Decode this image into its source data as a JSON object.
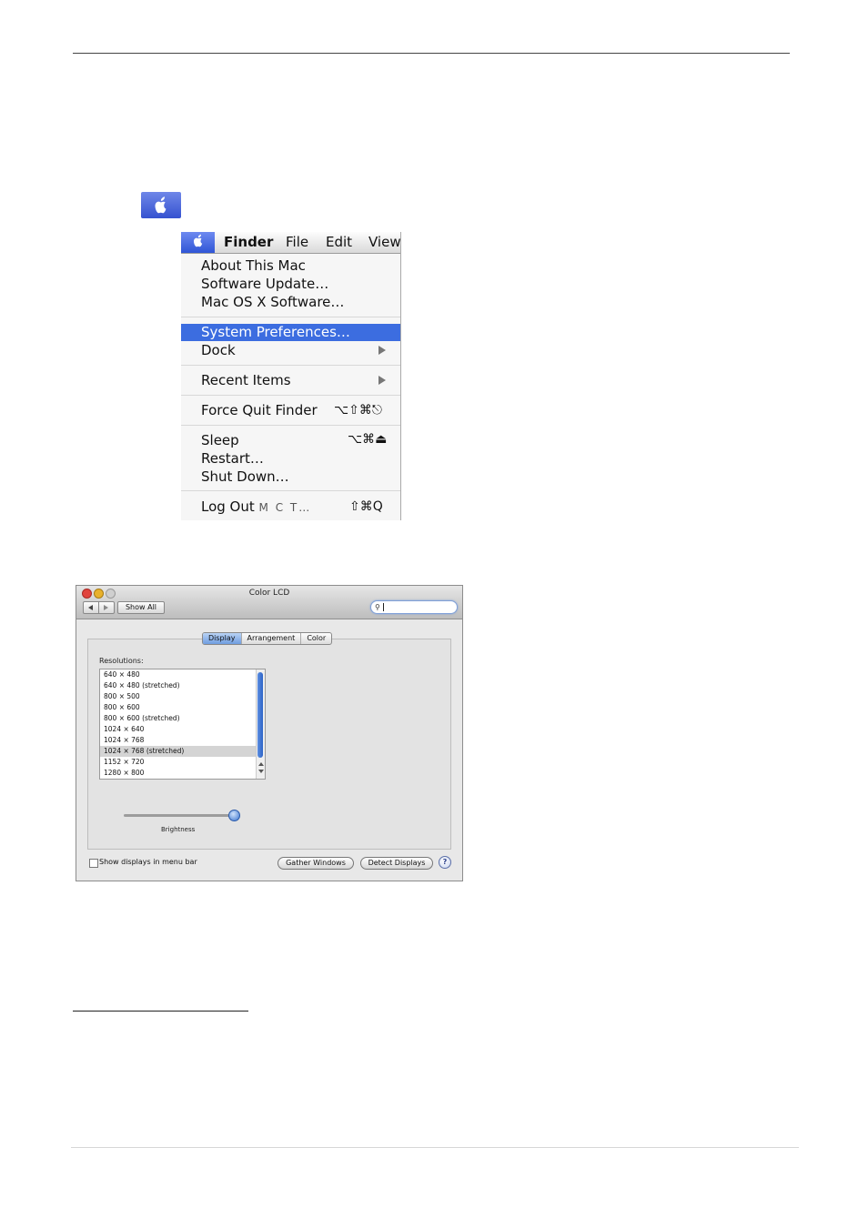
{
  "apple_menu": {
    "menubar": {
      "finder": "Finder",
      "file": "File",
      "edit": "Edit",
      "view": "View"
    },
    "items": {
      "about": "About This Mac",
      "software_update": "Software Update…",
      "macosx_software": "Mac OS X Software…",
      "system_preferences": "System Preferences…",
      "dock": "Dock",
      "recent_items": "Recent Items",
      "force_quit": "Force Quit Finder",
      "force_quit_shortcut": "⌥⇧⌘⎋",
      "sleep": "Sleep",
      "sleep_shortcut": "⌥⌘⏏",
      "restart": "Restart…",
      "shut_down": "Shut Down…",
      "log_out": "Log Out",
      "log_out_user": "M C T…",
      "log_out_shortcut": "⇧⌘Q"
    },
    "highlighted_item": "System Preferences…"
  },
  "prefs_window": {
    "title": "Color LCD",
    "show_all": "Show All",
    "search_placeholder": "",
    "tabs": [
      "Display",
      "Arrangement",
      "Color"
    ],
    "active_tab": "Display",
    "resolutions_label": "Resolutions:",
    "resolutions": [
      "640 × 480",
      "640 × 480 (stretched)",
      "800 × 500",
      "800 × 600",
      "800 × 600 (stretched)",
      "1024 × 640",
      "1024 × 768",
      "1024 × 768 (stretched)",
      "1152 × 720",
      "1280 × 800"
    ],
    "selected_resolution": "1024 × 768 (stretched)",
    "brightness_label": "Brightness",
    "brightness_level": 0.96,
    "show_in_menubar_label": "Show displays in menu bar",
    "show_in_menubar_checked": false,
    "gather_windows": "Gather Windows",
    "detect_displays": "Detect Displays",
    "help": "?"
  },
  "colors": {
    "menu_highlight": "#3c6de0",
    "apple_badge": "#4a66dd"
  }
}
